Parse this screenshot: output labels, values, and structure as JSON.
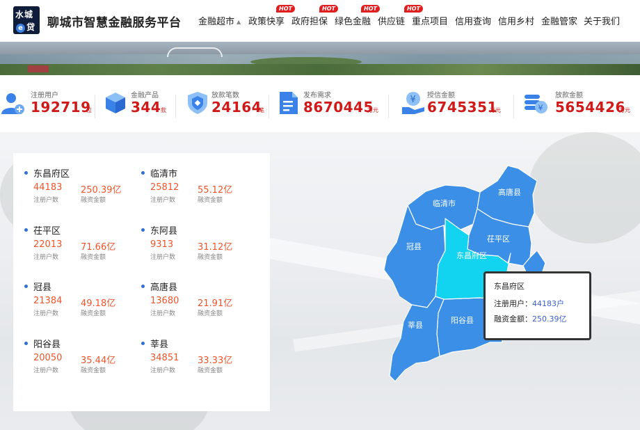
{
  "header": {
    "logo_line1": "水城",
    "logo_e": "e",
    "logo_line2": "贷",
    "site_title": "聊城市智慧金融服务平台",
    "nav": [
      {
        "label": "金融超市",
        "hot": "",
        "caret": "▲"
      },
      {
        "label": "政策快享",
        "hot": "HOT"
      },
      {
        "label": "政府担保",
        "hot": "HOT"
      },
      {
        "label": "绿色金融",
        "hot": "HOT"
      },
      {
        "label": "供应链",
        "hot": "HOT"
      },
      {
        "label": "重点项目",
        "hot": ""
      },
      {
        "label": "信用查询",
        "hot": ""
      },
      {
        "label": "信用乡村",
        "hot": ""
      },
      {
        "label": "金融管家",
        "hot": ""
      },
      {
        "label": "关于我们",
        "hot": ""
      }
    ]
  },
  "stats": [
    {
      "icon": "user-add-icon",
      "label": "注册用户",
      "value": "192719",
      "unit": "位"
    },
    {
      "icon": "cube-icon",
      "label": "金融产品",
      "value": "344",
      "unit": "款"
    },
    {
      "icon": "shield-loan-icon",
      "label": "放款笔数",
      "value": "24164",
      "unit": "笔"
    },
    {
      "icon": "document-icon",
      "label": "发布需求",
      "value": "8670445",
      "unit": "万元"
    },
    {
      "icon": "hand-yuan-icon",
      "label": "授信金额",
      "value": "6745351",
      "unit": "万元"
    },
    {
      "icon": "coins-icon",
      "label": "放款金额",
      "value": "5654426",
      "unit": "万元"
    }
  ],
  "regions": [
    {
      "name": "东昌府区",
      "users": "44183",
      "amount": "250.39亿",
      "users_caption": "注册户数",
      "amount_caption": "融资金额"
    },
    {
      "name": "临清市",
      "users": "25812",
      "amount": "55.12亿",
      "users_caption": "注册户数",
      "amount_caption": "融资金额"
    },
    {
      "name": "茌平区",
      "users": "22013",
      "amount": "71.66亿",
      "users_caption": "注册户数",
      "amount_caption": "融资金额"
    },
    {
      "name": "东阿县",
      "users": "9313",
      "amount": "31.12亿",
      "users_caption": "注册户数",
      "amount_caption": "融资金额"
    },
    {
      "name": "冠县",
      "users": "21384",
      "amount": "49.18亿",
      "users_caption": "注册户数",
      "amount_caption": "融资金额"
    },
    {
      "name": "高唐县",
      "users": "13680",
      "amount": "21.91亿",
      "users_caption": "注册户数",
      "amount_caption": "融资金额"
    },
    {
      "name": "阳谷县",
      "users": "20050",
      "amount": "35.44亿",
      "users_caption": "注册户数",
      "amount_caption": "融资金额"
    },
    {
      "name": "莘县",
      "users": "34851",
      "amount": "33.33亿",
      "users_caption": "注册户数",
      "amount_caption": "融资金额"
    }
  ],
  "map": {
    "labels": {
      "linqing": "临清市",
      "gaotang": "高唐县",
      "chiping": "茌平区",
      "guanxian": "冠县",
      "dongchangfu": "东昌府区",
      "shenxian": "莘县",
      "yanggu": "阳谷县"
    },
    "colors": {
      "default": "#3b8fe6",
      "highlight": "#12d3f0",
      "border": "#ffffff"
    }
  },
  "tooltip": {
    "title": "东昌府区",
    "users_label": "注册用户：",
    "users_value": "44183户",
    "amount_label": "融资金额：",
    "amount_value": "250.39亿"
  }
}
